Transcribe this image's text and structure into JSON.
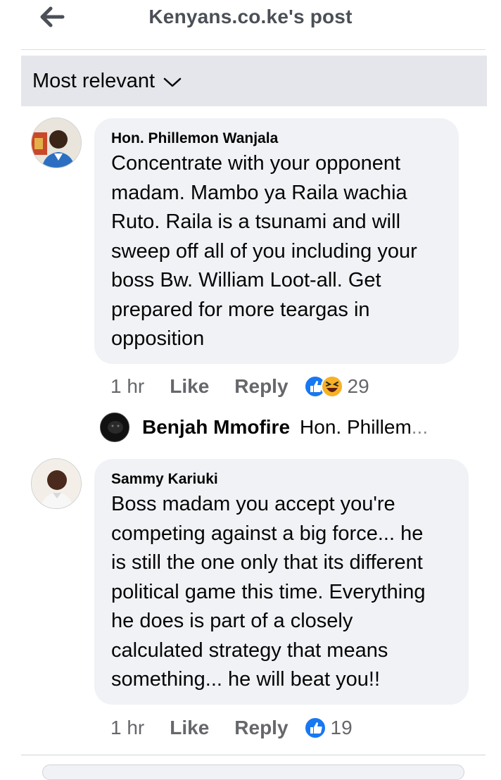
{
  "header": {
    "back_icon": "arrow-left-icon",
    "title": "Kenyans.co.ke's post"
  },
  "filter": {
    "label": "Most relevant",
    "chevron_icon": "chevron-down-icon"
  },
  "comments": [
    {
      "author": "Hon. Phillemon Wanjala",
      "text": "Concentrate with your opponent\nmadam. Mambo ya Raila wachia\nRuto. Raila is a tsunami and will\nsweep off all of you including your\nboss Bw. William Loot-all. Get\nprepared for more teargas in\nopposition",
      "time": "1 hr",
      "like_label": "Like",
      "reply_label": "Reply",
      "reactions": [
        "like-reaction-icon",
        "haha-reaction-icon"
      ],
      "reaction_count": "29",
      "reply": {
        "author": "Benjah Mmofire",
        "preview": "Hon. Phillem",
        "ellipsis": "..."
      }
    },
    {
      "author": "Sammy Kariuki",
      "text": "Boss madam you accept you're\ncompeting against a big force... he\nis still the one only that its different\npolitical game this time. Everything\nhe does is part of a closely\ncalculated strategy that means\nsomething... he will beat you!!",
      "time": "1 hr",
      "like_label": "Like",
      "reply_label": "Reply",
      "reactions": [
        "like-reaction-icon"
      ],
      "reaction_count": "19"
    }
  ],
  "colors": {
    "bubble": "#f0f2f5",
    "filter_bar": "#e4e6eb",
    "secondary_text": "#65676b",
    "like_blue": "#1877f2",
    "haha_yellow": "#f7b125"
  }
}
